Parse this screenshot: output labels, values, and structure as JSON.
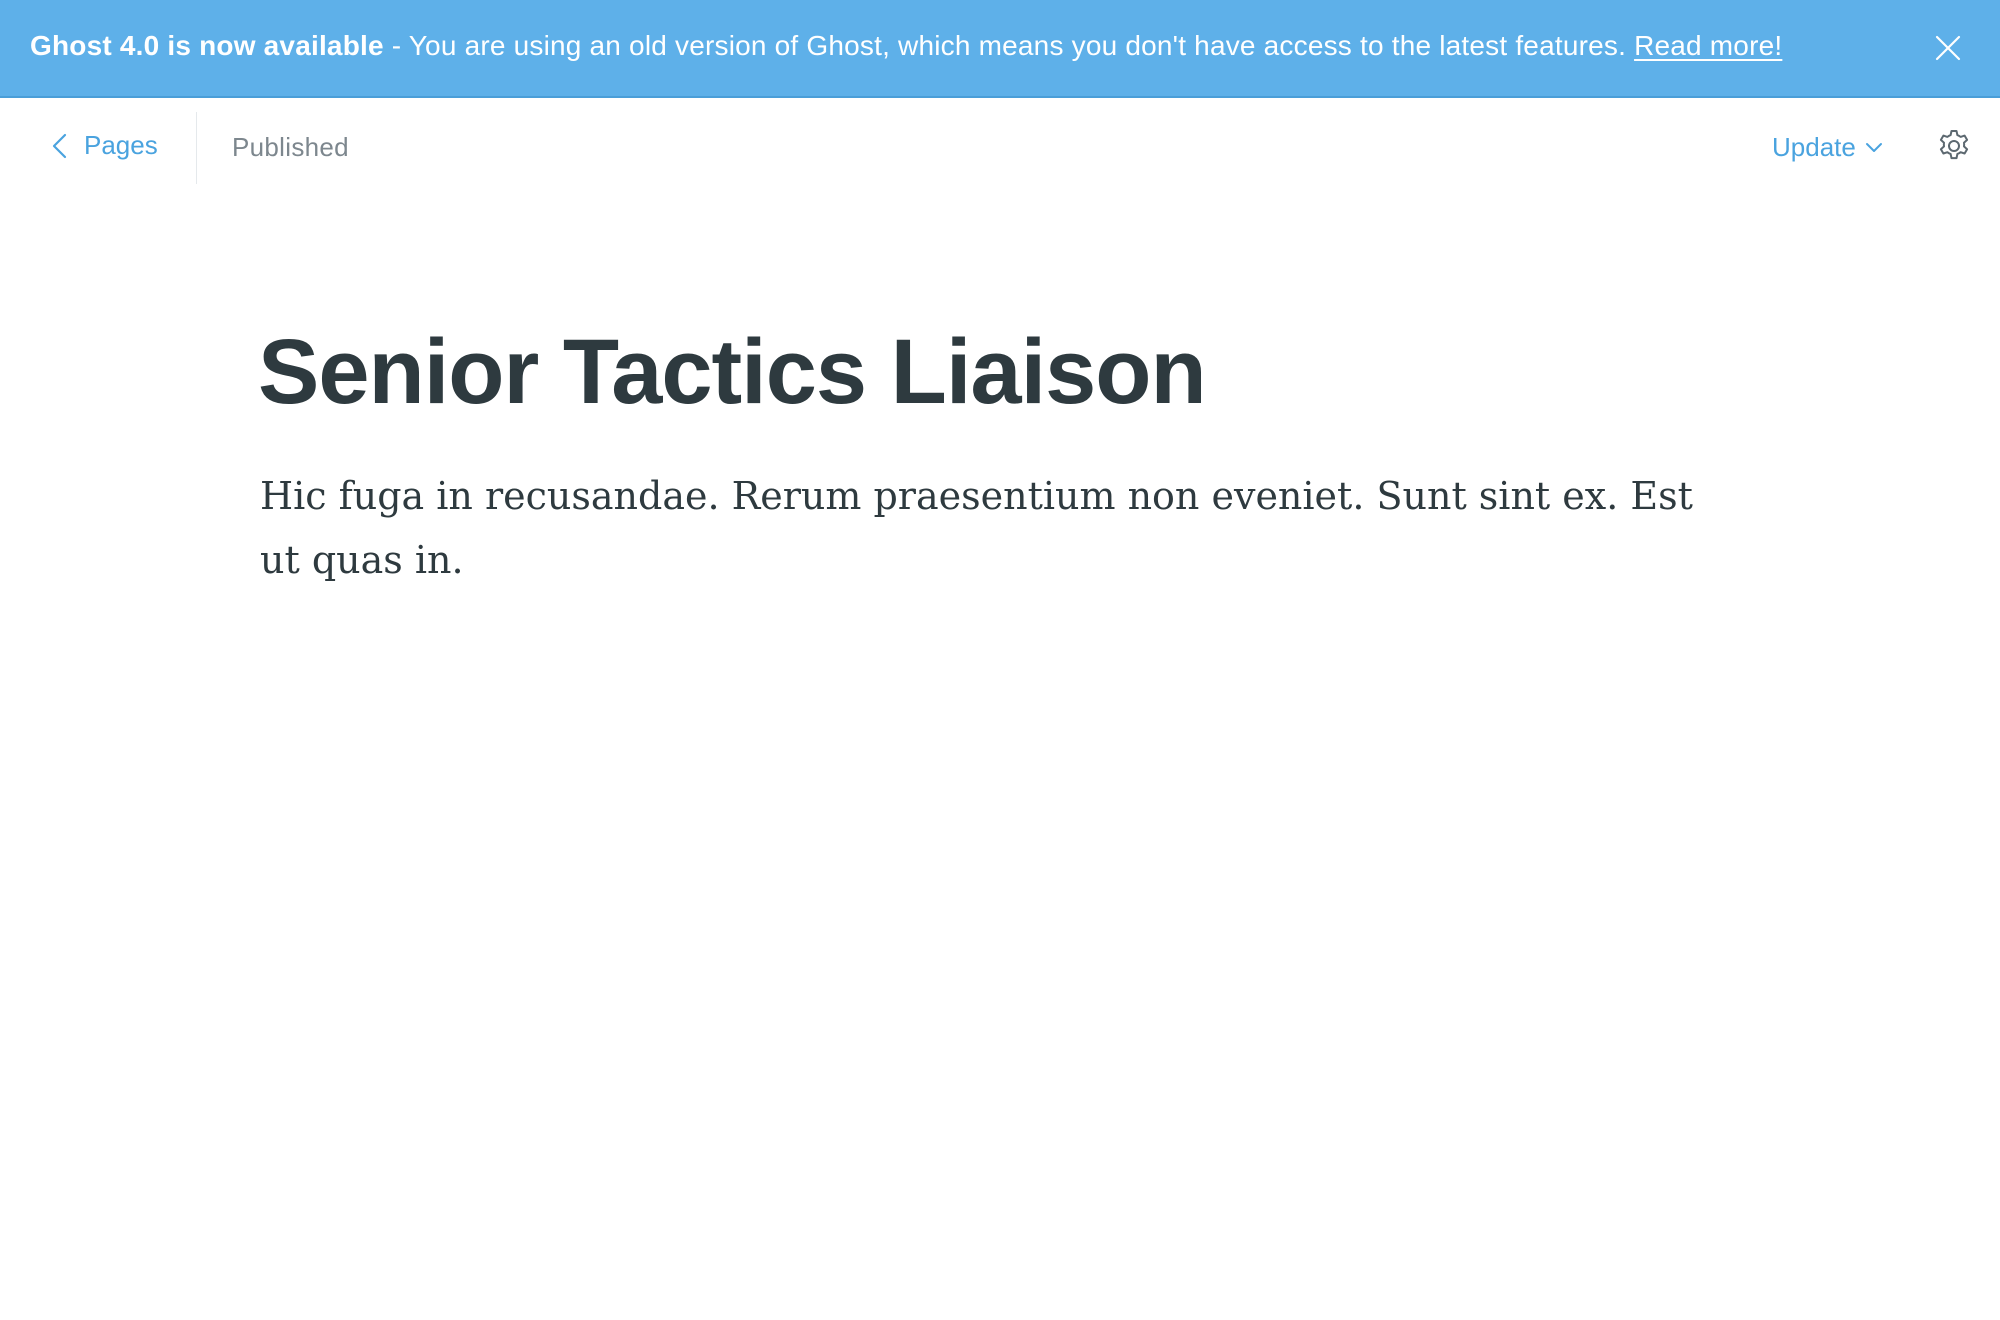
{
  "banner": {
    "headline": "Ghost 4.0 is now available",
    "message": " - You are using an old version of Ghost, which means you don't have access to the latest features. ",
    "link_label": "Read more!",
    "close_icon": "close-icon",
    "background_color": "#5eb0e9"
  },
  "header": {
    "back_label": "Pages",
    "back_icon": "chevron-left-icon",
    "status": "Published",
    "update_label": "Update",
    "update_icon": "chevron-down-icon",
    "settings_icon": "gear-icon",
    "accent_color": "#4aa3df"
  },
  "editor": {
    "title": "Senior Tactics Liaison",
    "body": "Hic fuga in recusandae. Rerum praesentium non eveniet. Sunt sint ex. Est ut quas in."
  }
}
